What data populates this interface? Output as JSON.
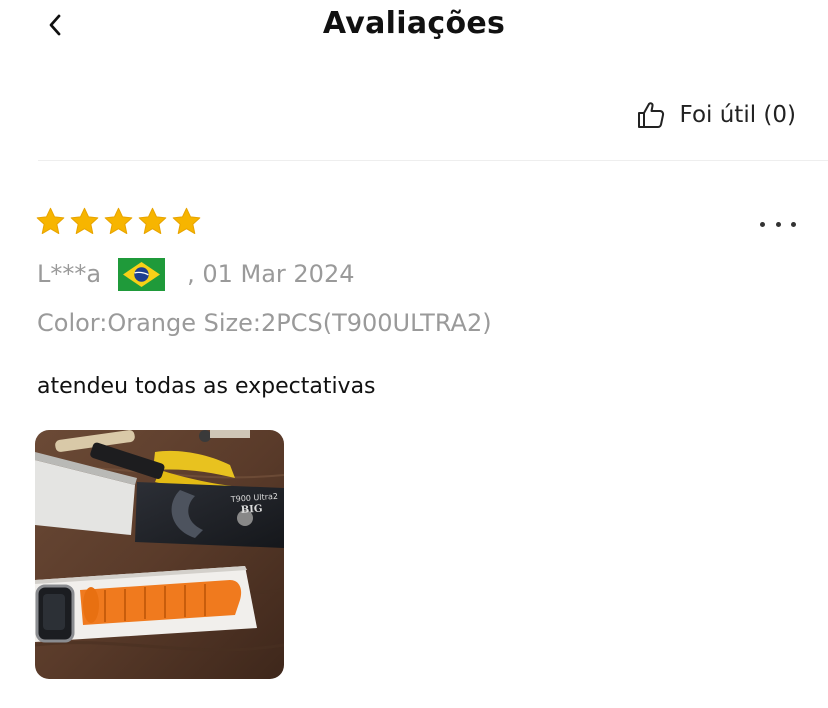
{
  "header": {
    "title": "Avaliações",
    "back_icon": "chevron-left-icon"
  },
  "helpful": {
    "label": "Foi útil (0)",
    "icon": "thumbs-up-icon"
  },
  "review": {
    "rating": 5,
    "max_rating": 5,
    "star_color": "#F7B500",
    "author": "L***a",
    "country_flag": "brazil-flag-icon",
    "date": ", 01 Mar 2024",
    "sku": "Color:Orange Size:2PCS(T900ULTRA2)",
    "text": "atendeu todas as expectativas",
    "photo": {
      "description_icon": "review-photo",
      "box_label_line1": "T900 Ultra2",
      "box_label_line2": "BIG",
      "strap_color": "#F07A1E"
    },
    "more_icon": "more-options-icon"
  }
}
